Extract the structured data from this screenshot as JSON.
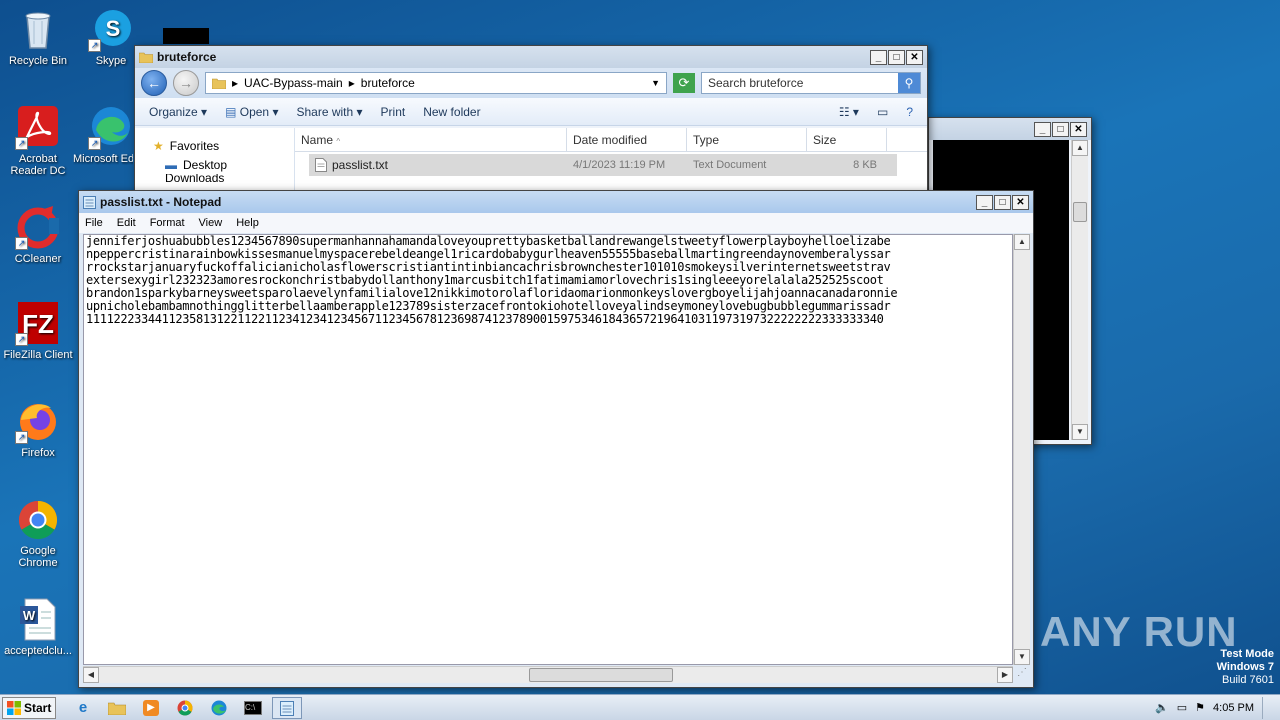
{
  "desktop": {
    "icons": [
      {
        "label": "Recycle Bin"
      },
      {
        "label": "Skype"
      },
      {
        "label": "Acrobat Reader DC"
      },
      {
        "label": "Microsoft Edge"
      },
      {
        "label": "CCleaner"
      },
      {
        "label": "FileZilla Client"
      },
      {
        "label": "Firefox"
      },
      {
        "label": "Google Chrome"
      },
      {
        "label": "acceptedclu..."
      }
    ]
  },
  "explorer": {
    "title": "bruteforce",
    "breadcrumb": [
      "UAC-Bypass-main",
      "bruteforce"
    ],
    "search_placeholder": "Search bruteforce",
    "toolbar": {
      "organize": "Organize",
      "open": "Open",
      "share_with": "Share with",
      "print": "Print",
      "new_folder": "New folder"
    },
    "nav": {
      "favorites": "Favorites",
      "desktop": "Desktop",
      "downloads": "Downloads"
    },
    "columns": {
      "name": "Name",
      "date_modified": "Date modified",
      "type": "Type",
      "size": "Size"
    },
    "files": [
      {
        "name": "passlist.txt",
        "date": "4/1/2023 11:19 PM",
        "type": "Text Document",
        "size": "8 KB"
      }
    ]
  },
  "notepad": {
    "title": "passlist.txt - Notepad",
    "menu": {
      "file": "File",
      "edit": "Edit",
      "format": "Format",
      "view": "View",
      "help": "Help"
    },
    "lines": [
      "jenniferjoshuabubbles1234567890supermanhannahamandaloveyouprettybasketballandrewangelstweetyflowerplayboyhelloelizabe",
      "npeppercristinarainbowkissesmanuelmyspacerebeldeangel1ricardobabygurlheaven55555baseballmartingreendaynovemberalyssar",
      "rrockstarjanuaryfuckoffalicianicholasflowerscristiantintinbiancachrisbrownchester101010smokeysilverinternetsweetstrav",
      "extersexygirl232323amoresrockonchristbabydollanthony1marcusbitch1fatimamiamorlovechris1singleeeyorelalala252525scoot",
      "brandon1sparkybarneysweetsparolaevelynfamilialove12nikkimotorolafloridaomarionmonkeyslovergboyelijahjoannacanadaronnie",
      "upnicholebambamnothingglitterbellaamberapple123789sisterzacefrontokiohotelloveyalindseymoneylovebugbubblegummarissadr",
      "11112223344112358131221122112341234123456711234567812369874123789001597534618436572196410311973197322222222333333340"
    ]
  },
  "taskbar": {
    "start": "Start",
    "time": "4:05 PM"
  },
  "watermark": {
    "brand": "ANY RUN",
    "mode": "Test Mode",
    "os": "Windows 7",
    "build": "Build 7601"
  }
}
